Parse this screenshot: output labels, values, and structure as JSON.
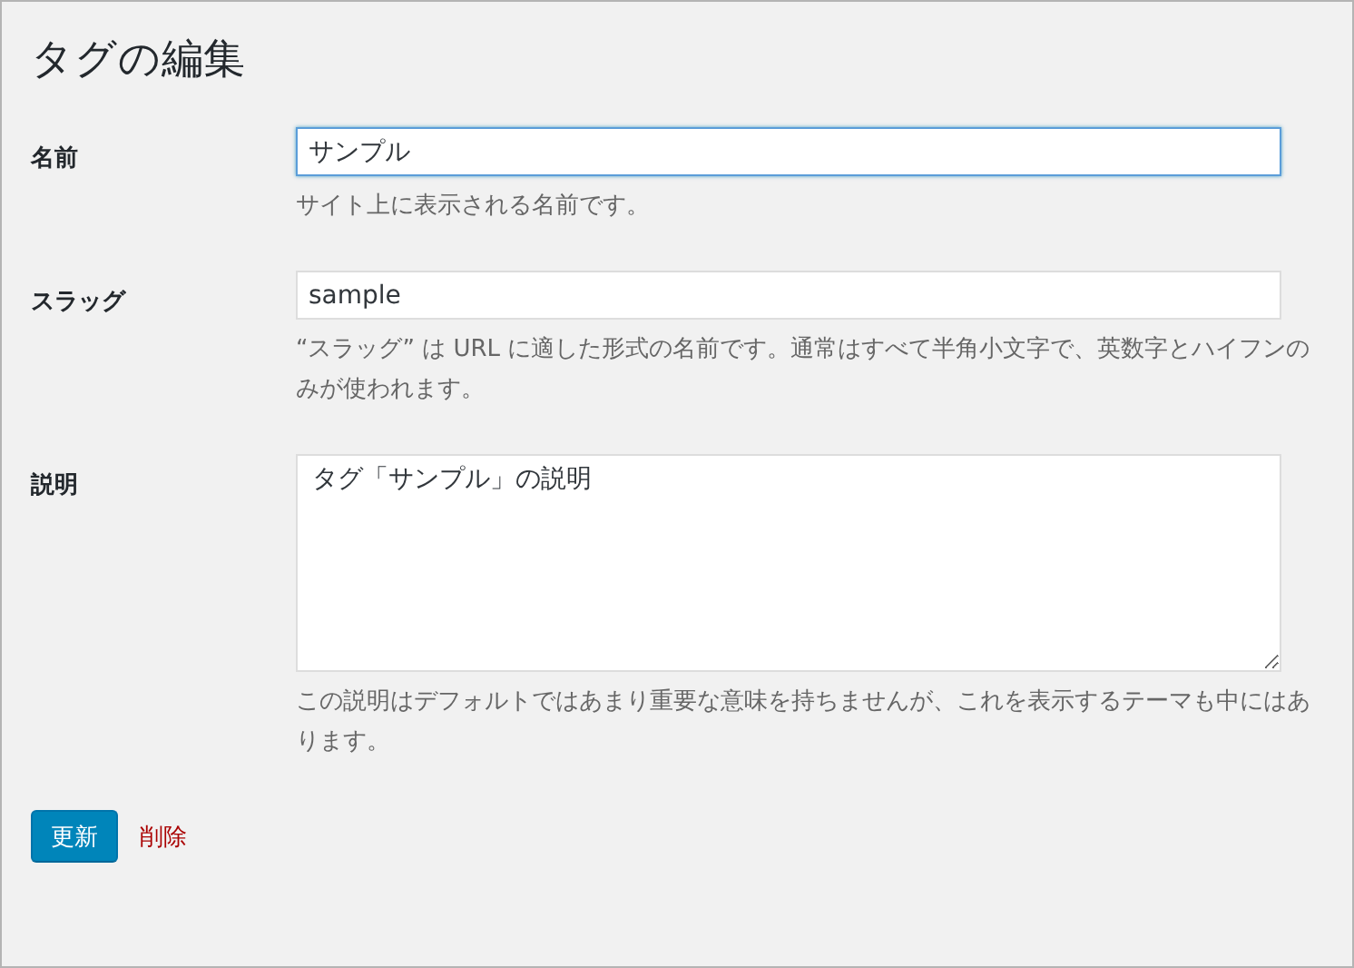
{
  "title": "タグの編集",
  "fields": [
    {
      "kind": "input",
      "label": "名前",
      "value": "サンプル",
      "focused": true,
      "help": "サイト上に表示される名前です。"
    },
    {
      "kind": "input",
      "label": "スラッグ",
      "value": "sample",
      "focused": false,
      "help": "“スラッグ” は URL に適した形式の名前です。通常はすべて半角小文字で、英数字とハイフンのみが使われます。"
    },
    {
      "kind": "textarea",
      "label": "説明",
      "value": "タグ「サンプル」の説明",
      "focused": false,
      "help": "この説明はデフォルトではあまり重要な意味を持ちませんが、これを表示するテーマも中にはあります。"
    }
  ],
  "actions": [
    {
      "kind": "primary",
      "label": "更新"
    },
    {
      "kind": "delete",
      "label": "削除"
    }
  ]
}
